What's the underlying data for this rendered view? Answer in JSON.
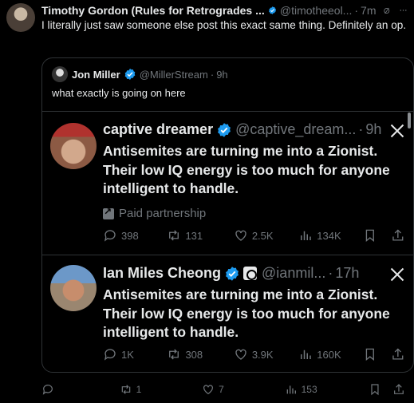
{
  "post": {
    "author_name": "Timothy Gordon (Rules for Retrogrades ...",
    "handle": "@timotheeol...",
    "separator": "·",
    "time": "7m",
    "text": "I literally just saw someone else post this exact same thing.  Definitely an op."
  },
  "quote": {
    "author_name": "Jon Miller",
    "handle": "@MillerStream",
    "separator": "·",
    "time": "9h",
    "text": "what exactly is going on here",
    "embeds": [
      {
        "author_name": "captive dreamer",
        "handle": "@captive_dream...",
        "separator": "·",
        "time": "9h",
        "text": "Antisemites are turning me into a Zionist. Their low IQ energy is too much for anyone intelligent to handle.",
        "paid_label": "Paid partnership",
        "replies": "398",
        "reposts": "131",
        "likes": "2.5K",
        "views": "134K"
      },
      {
        "author_name": "Ian Miles Cheong",
        "handle": "@ianmil...",
        "separator": "·",
        "time": "17h",
        "text": "Antisemites are turning me into a Zionist. Their low IQ energy is too much for anyone intelligent to handle.",
        "replies": "1K",
        "reposts": "308",
        "likes": "3.9K",
        "views": "160K"
      }
    ]
  },
  "actions": {
    "reposts": "1",
    "likes": "7",
    "views": "153"
  },
  "colors": {
    "background": "#000000",
    "text": "#e7e9ea",
    "muted": "#71767b",
    "border": "#2f3336",
    "verified": "#1d9bf0"
  }
}
